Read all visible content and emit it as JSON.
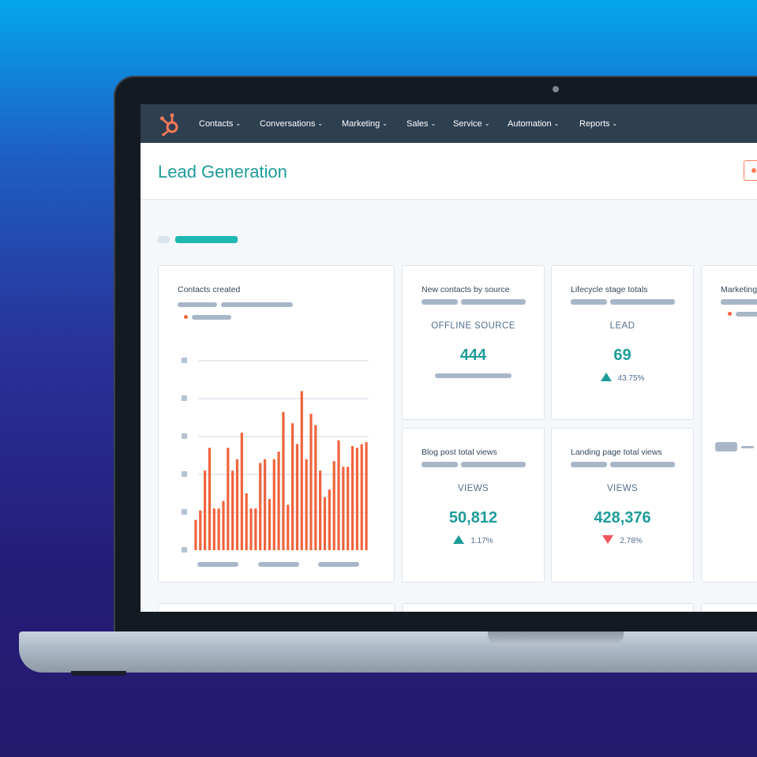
{
  "nav": {
    "logo_icon": "hubspot-sprocket-icon",
    "items": [
      {
        "label": "Contacts"
      },
      {
        "label": "Conversations"
      },
      {
        "label": "Marketing"
      },
      {
        "label": "Sales"
      },
      {
        "label": "Service"
      },
      {
        "label": "Automation"
      },
      {
        "label": "Reports"
      }
    ]
  },
  "header": {
    "title": "Lead Generation"
  },
  "cards": {
    "contacts_created": {
      "title": "Contacts created"
    },
    "new_contacts": {
      "title": "New contacts by source",
      "label": "OFFLINE SOURCE",
      "value": "444"
    },
    "lifecycle": {
      "title": "Lifecycle stage totals",
      "label": "LEAD",
      "value": "69",
      "change": "43.75%",
      "direction": "up"
    },
    "marketing": {
      "title": "Marketing"
    },
    "blog_views": {
      "title": "Blog post total views",
      "label": "VIEWS",
      "value": "50,812",
      "change": "1.17%",
      "direction": "up"
    },
    "landing_views": {
      "title": "Landing page total views",
      "label": "VIEWS",
      "value": "428,376",
      "change": "2.78%",
      "direction": "down"
    }
  },
  "colors": {
    "accent": "#1e9c9a",
    "bar": "#f0643c",
    "nav": "#2e3f50",
    "negative": "#f2545b"
  },
  "chart_data": {
    "type": "bar",
    "title": "Contacts created",
    "values": [
      16,
      21,
      42,
      54,
      22,
      22,
      26,
      54,
      42,
      48,
      62,
      30,
      22,
      22,
      46,
      48,
      27,
      48,
      52,
      73,
      24,
      67,
      56,
      84,
      48,
      72,
      66,
      42,
      28,
      32,
      47,
      58,
      44,
      44,
      55,
      54,
      56,
      57
    ],
    "ylim": [
      0,
      100
    ],
    "grid": true
  }
}
